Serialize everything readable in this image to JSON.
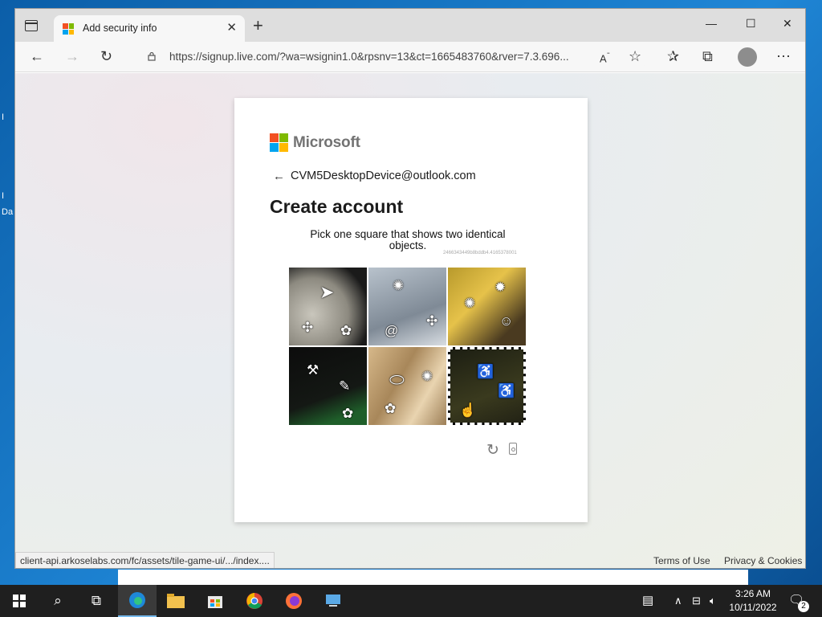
{
  "desktop": {
    "icon_fragments": [
      "I",
      "I",
      "Da"
    ]
  },
  "browser": {
    "tab": {
      "title": "Add security info",
      "close_symbol": "✕"
    },
    "new_tab_symbol": "+",
    "window_controls": {
      "minimize": "—",
      "maximize": "☐",
      "close": "✕"
    },
    "address_bar": {
      "url": "https://signup.live.com/?wa=wsignin1.0&rpsnv=13&ct=1665483760&rver=7.3.696..."
    },
    "toolbar_icons": [
      "back-icon",
      "forward-icon",
      "refresh-icon",
      "lock-icon",
      "read-aloud-icon",
      "add-favorite-icon",
      "favorites-icon",
      "collections-icon",
      "profile-icon",
      "more-icon"
    ],
    "status_url": "client-api.arkoselabs.com/fc/assets/tile-game-ui/.../index...."
  },
  "page": {
    "brand": "Microsoft",
    "identity": "CVM5DesktopDevice@outlook.com",
    "heading": "Create account",
    "captcha": {
      "prompt": "Pick one square that shows two identical objects.",
      "session_id": "2466343449b8bddb4.4165378001",
      "tiles": [
        {
          "id": 1,
          "scene": "moon-surface",
          "selected": false
        },
        {
          "id": 2,
          "scene": "cloudy-sky",
          "selected": false
        },
        {
          "id": 3,
          "scene": "yellow-wheel",
          "selected": false
        },
        {
          "id": 4,
          "scene": "dark-green",
          "selected": false
        },
        {
          "id": 5,
          "scene": "rock-texture",
          "selected": false
        },
        {
          "id": 6,
          "scene": "dark-olive",
          "selected": true
        }
      ]
    },
    "footer": {
      "terms": "Terms of Use",
      "privacy": "Privacy & Cookies"
    },
    "ms_colors": [
      "#f25022",
      "#7fba00",
      "#00a4ef",
      "#ffb900"
    ]
  },
  "taskbar": {
    "apps": [
      "start-icon",
      "search-icon",
      "task-view-icon",
      "edge-icon",
      "file-explorer-icon",
      "store-icon",
      "chrome-icon",
      "firefox-icon",
      "remote-desktop-icon"
    ],
    "clock": {
      "time": "3:26 AM",
      "date": "10/11/2022"
    },
    "notifications": "2"
  }
}
